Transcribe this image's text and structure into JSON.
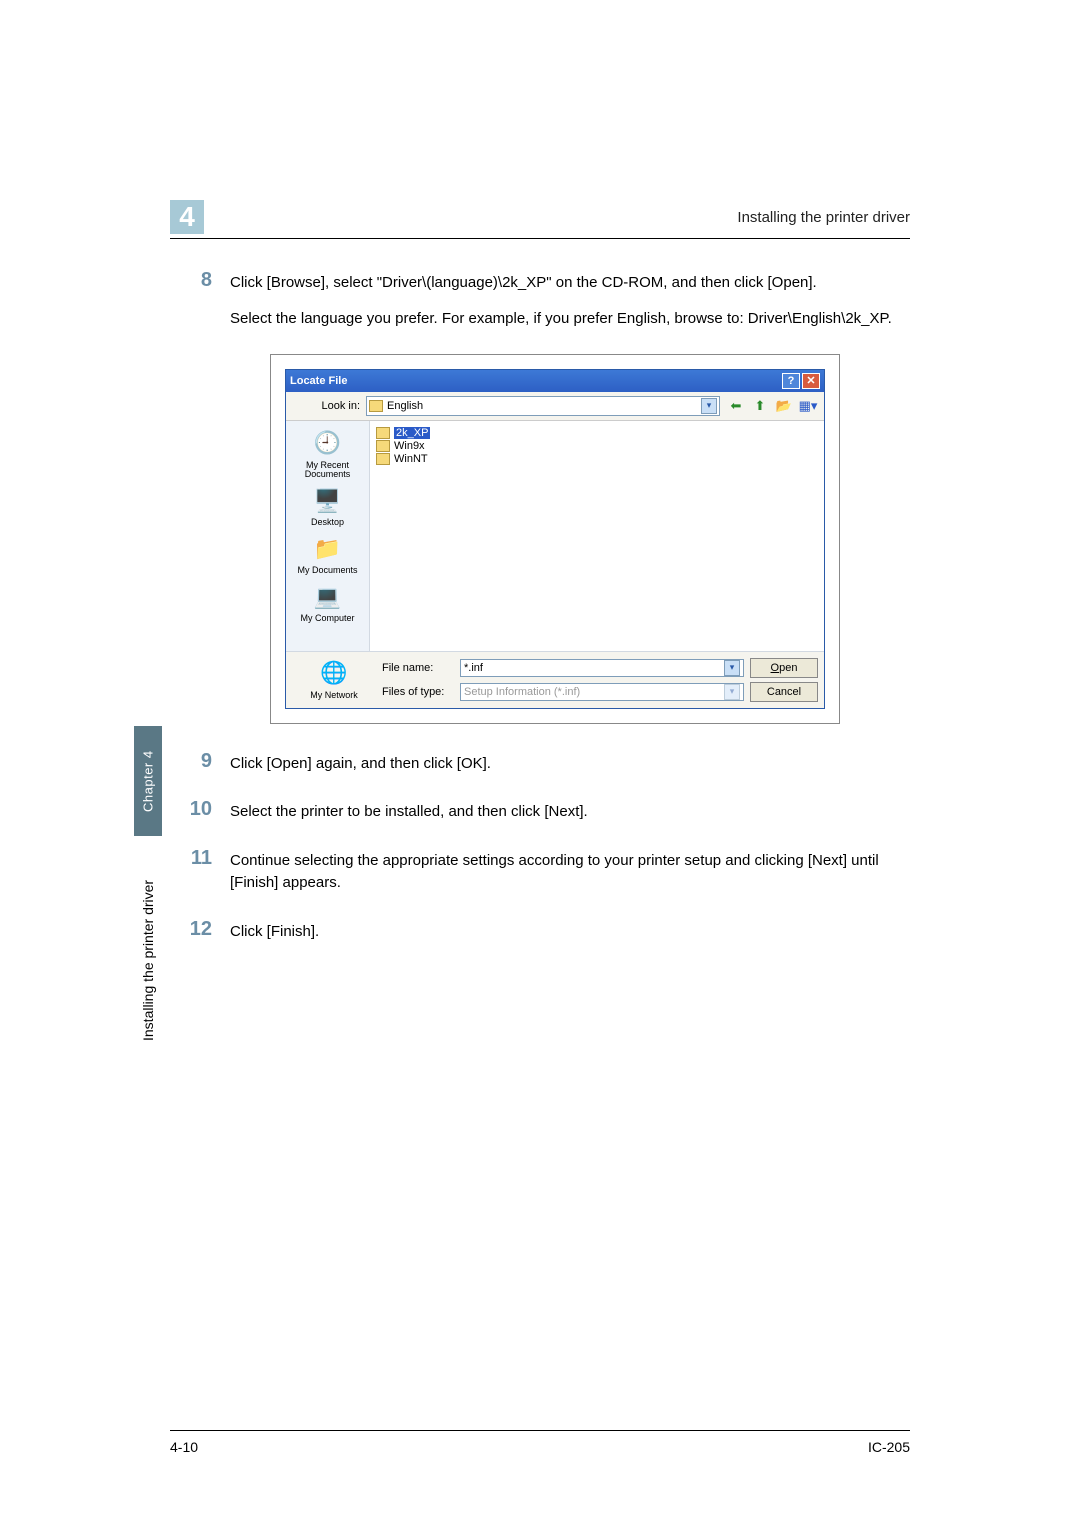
{
  "chapter_num": "4",
  "header_title": "Installing the printer driver",
  "steps": {
    "s8_num": "8",
    "s8_p1": "Click [Browse], select \"Driver\\(language)\\2k_XP\" on the CD-ROM, and then click [Open].",
    "s8_p2": "Select the language you prefer. For example, if you prefer English, browse to: Driver\\English\\2k_XP.",
    "s9_num": "9",
    "s9_p1": "Click [Open] again, and then click [OK].",
    "s10_num": "10",
    "s10_p1": "Select the printer to be installed, and then click [Next].",
    "s11_num": "11",
    "s11_p1": "Continue selecting the appropriate settings according to your printer setup and clicking [Next] until [Finish] appears.",
    "s12_num": "12",
    "s12_p1": "Click [Finish]."
  },
  "dialog": {
    "title": "Locate File",
    "help": "?",
    "close": "✕",
    "lookin_label": "Look in:",
    "lookin_value": "English",
    "tool_back": "⬅",
    "tool_up": "⬆",
    "tool_new": "📂",
    "tool_views": "▦▾",
    "sidebar": {
      "recent": "My Recent Documents",
      "desktop": "Desktop",
      "mydocs": "My Documents",
      "mycomp": "My Computer",
      "mynet": "My Network"
    },
    "files": {
      "f1": "2k_XP",
      "f2": "Win9x",
      "f3": "WinNT"
    },
    "filename_label": "File name:",
    "filename_value": "*.inf",
    "filetype_label": "Files of type:",
    "filetype_value": "Setup Information (*.inf)",
    "open_btn": "Open",
    "cancel_btn": "Cancel"
  },
  "vtab_label": "Chapter 4",
  "vtext_label": "Installing the printer driver",
  "footer_left": "4-10",
  "footer_right": "IC-205"
}
